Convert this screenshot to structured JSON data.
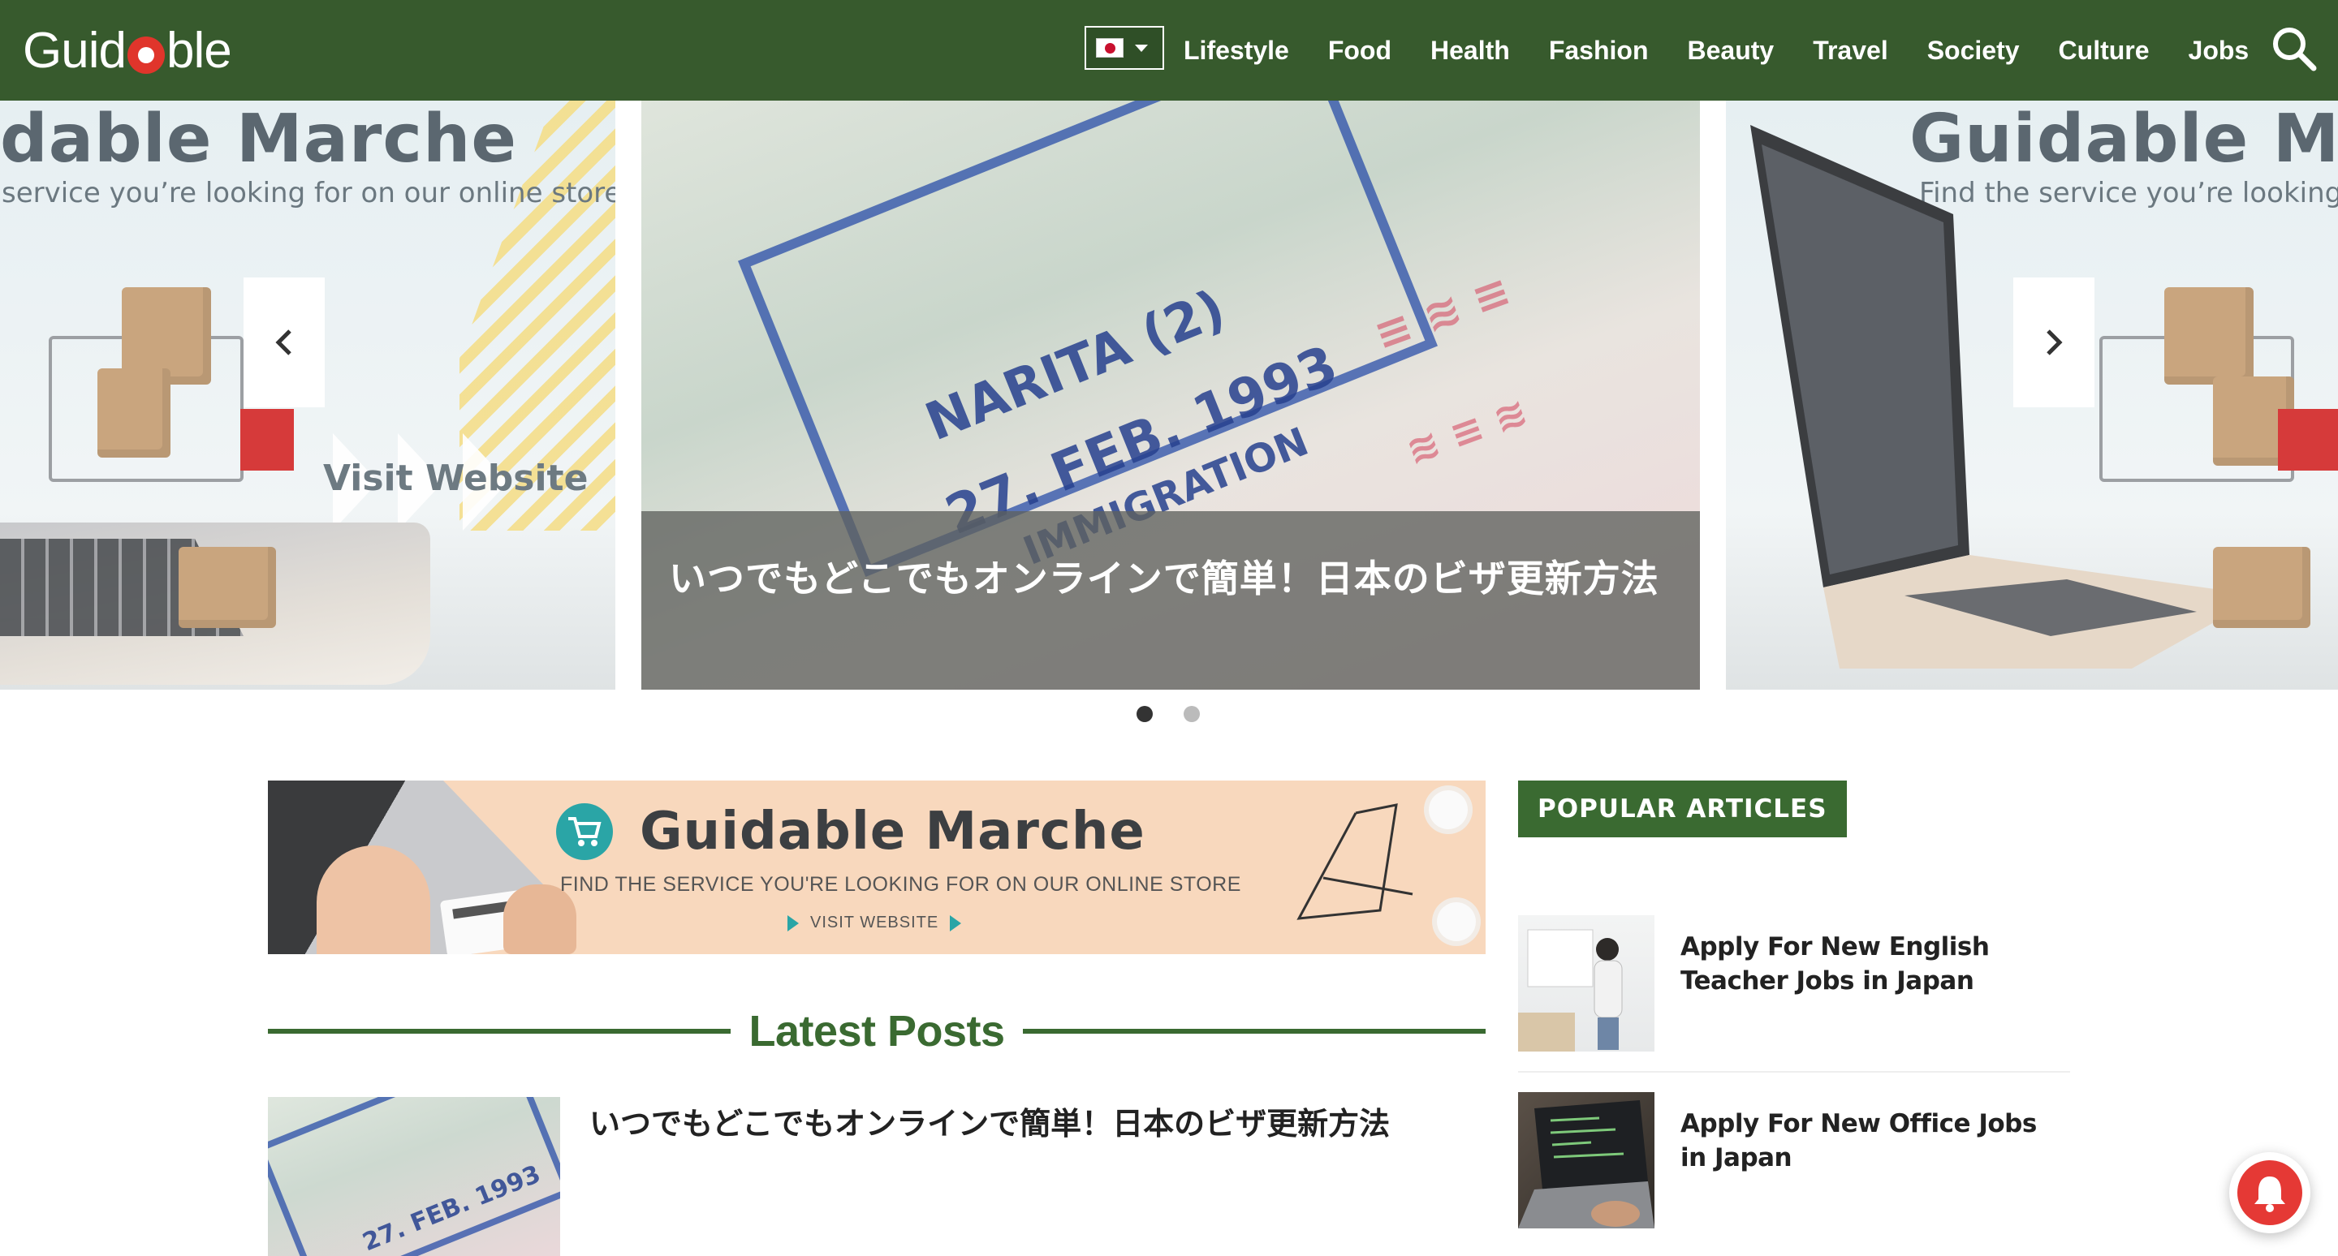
{
  "brand": {
    "logo_pre": "Guid",
    "logo_post": "ble"
  },
  "nav": {
    "language_flag": "japan-flag-icon",
    "items": [
      "Lifestyle",
      "Food",
      "Health",
      "Fashion",
      "Beauty",
      "Travel",
      "Society",
      "Culture",
      "Jobs"
    ],
    "search_icon": "search-icon"
  },
  "hero": {
    "left_slide": {
      "title": "dable Marche",
      "subtitle": "service you’re looking for on our online store",
      "cta": "Visit Website"
    },
    "main_slide": {
      "caption": "いつでもどこでもオンラインで簡単！日本のビザ更新方法",
      "stamp_lines": [
        "NARITA (2)",
        "27. FEB. 1993",
        "IMMIGRATION"
      ]
    },
    "right_slide": {
      "title": "Guidable Ma",
      "subtitle": "Find the service you’re looking"
    },
    "prev_icon": "chevron-left-icon",
    "next_icon": "chevron-right-icon",
    "dots": 2,
    "active_dot": 0
  },
  "banner": {
    "title": "Guidable Marche",
    "subtitle": "FIND THE SERVICE YOU'RE LOOKING FOR ON OUR ONLINE STORE",
    "cta": "VISIT WEBSITE",
    "icon": "cart-icon"
  },
  "latest": {
    "heading": "Latest Posts",
    "posts": [
      {
        "title": "いつでもどこでもオンラインで簡単！日本のビザ更新方法"
      }
    ]
  },
  "popular": {
    "heading": "POPULAR ARTICLES",
    "items": [
      {
        "title": "Apply For New English Teacher Jobs in Japan"
      },
      {
        "title": "Apply For New Office Jobs in Japan"
      }
    ]
  },
  "notification": {
    "icon": "bell-icon"
  },
  "colors": {
    "nav_bg": "#375a2d",
    "accent_green": "#3a6a31",
    "bell_red": "#e53935"
  }
}
